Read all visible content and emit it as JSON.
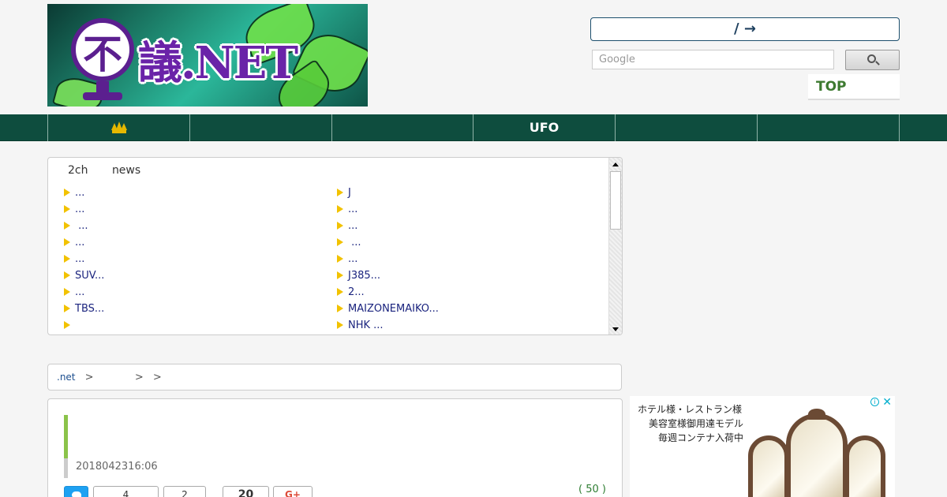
{
  "header": {
    "logo_title": "議.NET",
    "logo_mark": "不",
    "top_bar_text": "/ →",
    "search_placeholder": "Google",
    "top_link": "TOP"
  },
  "nav": {
    "items": [
      "",
      "",
      "",
      "UFO",
      "",
      ""
    ]
  },
  "rss": {
    "tabs": [
      "2ch",
      "news"
    ],
    "left": [
      "...",
      "...",
      " ...",
      "...",
      "...",
      "SUV...",
      "...",
      "TBS...",
      ""
    ],
    "right": [
      "J",
      "...",
      "...",
      " ...",
      "...",
      "J385...",
      "2...",
      "MAIZONEMAIKO...",
      "NHK ..."
    ]
  },
  "breadcrumb": {
    "site": ".net",
    "sep1": ">",
    "sep2": ">",
    "sep3": ">"
  },
  "article": {
    "date": "2018042316:06",
    "comment_count": "( 50 )",
    "share_counts": [
      "4",
      "2",
      "20"
    ]
  },
  "ad": {
    "line1": "ホテル様・レストラン様",
    "line2": "美容室様御用達モデル",
    "line3": "毎週コンテナ入荷中",
    "close": "✕",
    "info": "i"
  },
  "colors": {
    "nav_bg": "#0e4d3e",
    "accent_green": "#8bc34a",
    "link_blue": "#1a237e",
    "logo_purple": "#6a23a8"
  }
}
